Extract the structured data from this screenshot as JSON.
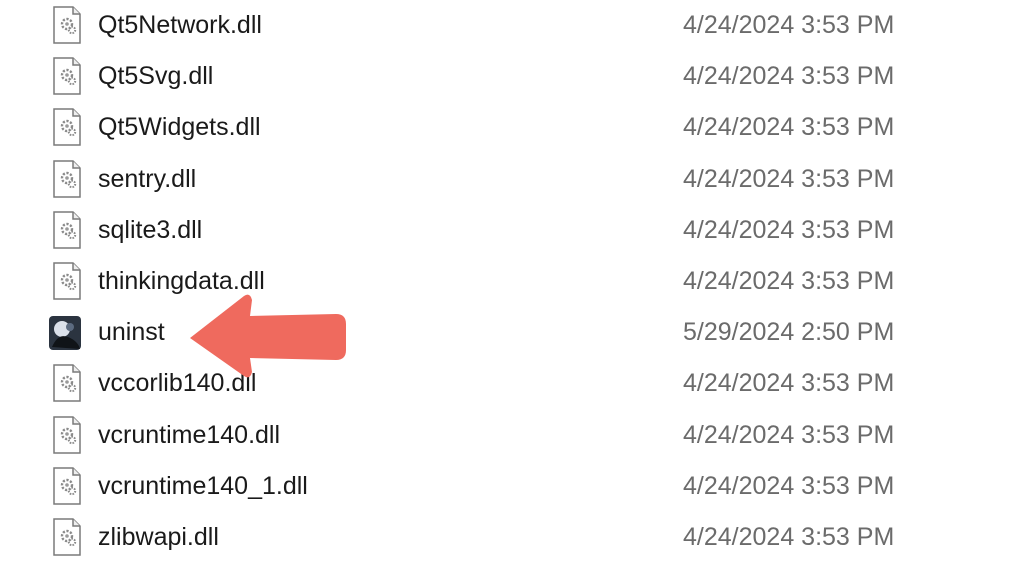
{
  "files": [
    {
      "name": "Qt5Network.dll",
      "date": "4/24/2024 3:53 PM",
      "icon": "dll-file-icon"
    },
    {
      "name": "Qt5Svg.dll",
      "date": "4/24/2024 3:53 PM",
      "icon": "dll-file-icon"
    },
    {
      "name": "Qt5Widgets.dll",
      "date": "4/24/2024 3:53 PM",
      "icon": "dll-file-icon"
    },
    {
      "name": "sentry.dll",
      "date": "4/24/2024 3:53 PM",
      "icon": "dll-file-icon"
    },
    {
      "name": "sqlite3.dll",
      "date": "4/24/2024 3:53 PM",
      "icon": "dll-file-icon"
    },
    {
      "name": "thinkingdata.dll",
      "date": "4/24/2024 3:53 PM",
      "icon": "dll-file-icon"
    },
    {
      "name": "uninst",
      "date": "5/29/2024 2:50 PM",
      "icon": "app-executable-icon"
    },
    {
      "name": "vccorlib140.dll",
      "date": "4/24/2024 3:53 PM",
      "icon": "dll-file-icon"
    },
    {
      "name": "vcruntime140.dll",
      "date": "4/24/2024 3:53 PM",
      "icon": "dll-file-icon"
    },
    {
      "name": "vcruntime140_1.dll",
      "date": "4/24/2024 3:53 PM",
      "icon": "dll-file-icon"
    },
    {
      "name": "zlibwapi.dll",
      "date": "4/24/2024 3:53 PM",
      "icon": "dll-file-icon"
    }
  ],
  "annotation": {
    "icon": "red-arrow-icon",
    "color": "#ef6a5e",
    "points_to": "uninst"
  }
}
